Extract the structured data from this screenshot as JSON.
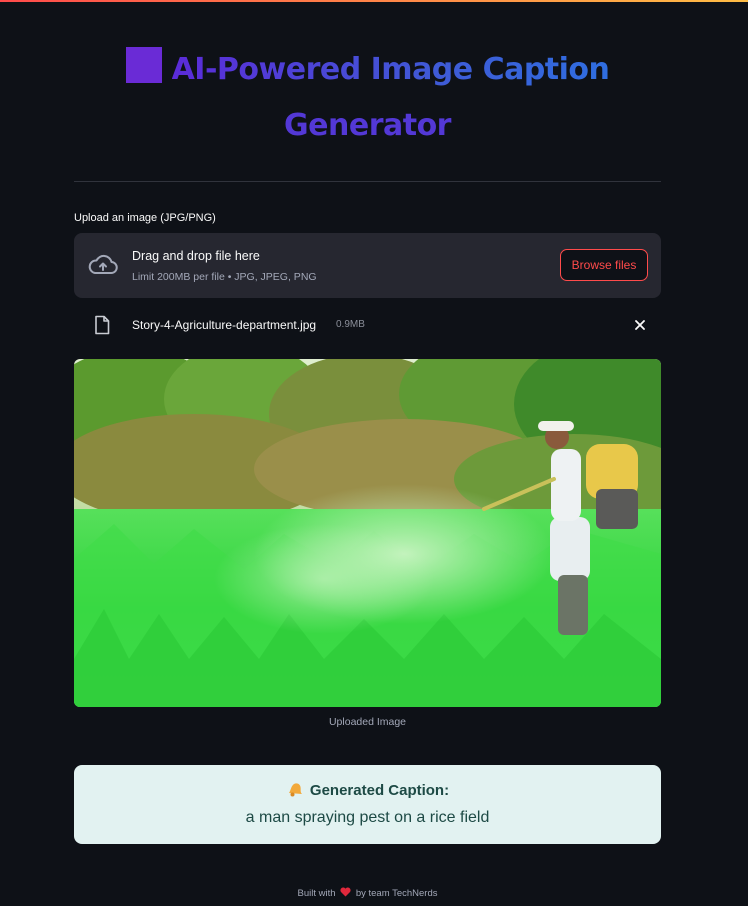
{
  "header": {
    "title_line1": "AI-Powered Image Caption",
    "title_line2": "Generator",
    "title_icon": "purple-square",
    "accent_colors": [
      "#6a2bd6",
      "#3f5ad6",
      "#2f6ee0"
    ]
  },
  "uploader": {
    "label": "Upload an image (JPG/PNG)",
    "drop_title": "Drag and drop file here",
    "drop_sub": "Limit 200MB per file • JPG, JPEG, PNG",
    "browse_label": "Browse files",
    "icon": "cloud-upload-icon"
  },
  "file": {
    "name": "Story-4-Agriculture-department.jpg",
    "size": "0.9MB",
    "icon": "file-icon",
    "remove_icon": "close-icon"
  },
  "image": {
    "caption": "Uploaded Image"
  },
  "result": {
    "heading": "Generated Caption:",
    "text": "a man spraying pest on a rice field",
    "icon": "bell-icon",
    "background": "#e2f2f1"
  },
  "footer": {
    "prefix": "Built with",
    "suffix": "by team TechNerds",
    "icon": "heart-icon"
  }
}
